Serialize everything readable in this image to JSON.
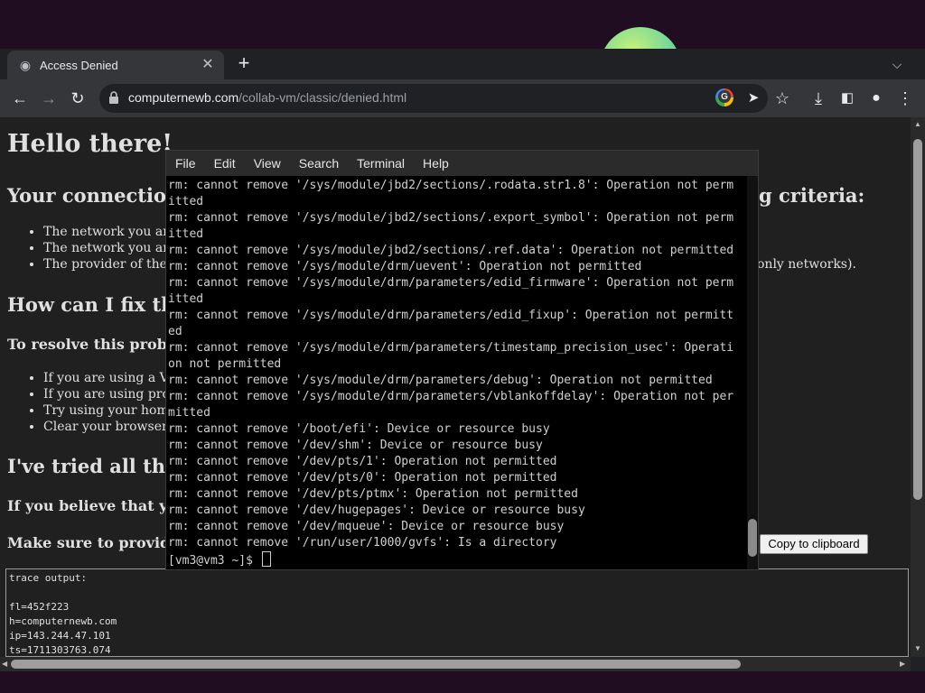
{
  "browser": {
    "tab": {
      "title": "Access Denied"
    },
    "url": {
      "host": "computernewb.com",
      "path": "/collab-vm/classic/denied.html"
    }
  },
  "page": {
    "heading": "Hello there!",
    "section1": {
      "title_start": "Your connection ",
      "title_end": "g criteria:"
    },
    "bullets1": [
      {
        "start": "The network you are",
        "end": ""
      },
      {
        "start": "The network you are",
        "end": ""
      },
      {
        "start": "The provider of the n",
        "end": "only networks)."
      }
    ],
    "section2": {
      "title": "How can I fix this"
    },
    "resolve": {
      "title": "To resolve this problem"
    },
    "bullets2": [
      "If you are using a VP",
      "If you are using prog",
      "Try using your home",
      "Clear your browser c"
    ],
    "section3": {
      "title": "I've tried all that,"
    },
    "believe": {
      "title": "If you believe that you"
    },
    "provide": {
      "title": "Make sure to provide"
    },
    "copy_button": "Copy to clipboard",
    "trace": [
      "trace output:",
      "",
      "fl=452f223",
      "h=computernewb.com",
      "ip=143.244.47.101",
      "ts=1711303763.074"
    ]
  },
  "terminal": {
    "menu": [
      "File",
      "Edit",
      "View",
      "Search",
      "Terminal",
      "Help"
    ],
    "lines": [
      "rm: cannot remove '/sys/module/jbd2/sections/.rodata.str1.8': Operation not perm",
      "itted",
      "rm: cannot remove '/sys/module/jbd2/sections/.export_symbol': Operation not perm",
      "itted",
      "rm: cannot remove '/sys/module/jbd2/sections/.ref.data': Operation not permitted",
      "rm: cannot remove '/sys/module/drm/uevent': Operation not permitted",
      "rm: cannot remove '/sys/module/drm/parameters/edid_firmware': Operation not perm",
      "itted",
      "rm: cannot remove '/sys/module/drm/parameters/edid_fixup': Operation not permitt",
      "ed",
      "rm: cannot remove '/sys/module/drm/parameters/timestamp_precision_usec': Operati",
      "on not permitted",
      "rm: cannot remove '/sys/module/drm/parameters/debug': Operation not permitted",
      "rm: cannot remove '/sys/module/drm/parameters/vblankoffdelay': Operation not per",
      "mitted",
      "rm: cannot remove '/boot/efi': Device or resource busy",
      "rm: cannot remove '/dev/shm': Device or resource busy",
      "rm: cannot remove '/dev/pts/1': Operation not permitted",
      "rm: cannot remove '/dev/pts/0': Operation not permitted",
      "rm: cannot remove '/dev/pts/ptmx': Operation not permitted",
      "rm: cannot remove '/dev/hugepages': Device or resource busy",
      "rm: cannot remove '/dev/mqueue': Device or resource busy",
      "rm: cannot remove '/run/user/1000/gvfs': Is a directory"
    ],
    "prompt": "[vm3@vm3 ~]$ "
  }
}
